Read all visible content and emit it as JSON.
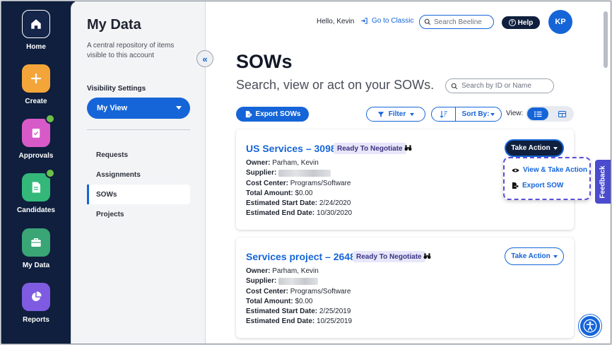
{
  "colors": {
    "rail_bg": "#0f1f3d",
    "accent": "#1565d8",
    "badge_bg": "#e7e6fb",
    "feedback": "#4a4bcd",
    "notification": "#6cc04a"
  },
  "rail": {
    "items": [
      {
        "label": "Home",
        "icon": "home-icon",
        "color": "#16254a",
        "notification": false
      },
      {
        "label": "Create",
        "icon": "plus-icon",
        "color": "#f4a53a",
        "notification": false
      },
      {
        "label": "Approvals",
        "icon": "clipboard-check-icon",
        "color": "#d85ac8",
        "notification": true
      },
      {
        "label": "Candidates",
        "icon": "document-icon",
        "color": "#34b87a",
        "notification": true
      },
      {
        "label": "My Data",
        "icon": "briefcase-icon",
        "color": "#3aa575",
        "notification": false
      },
      {
        "label": "Reports",
        "icon": "pie-chart-icon",
        "color": "#7e5be0",
        "notification": false
      }
    ]
  },
  "sidebar": {
    "title": "My Data",
    "description": "A central repository of items visible to this account",
    "visibility_label": "Visibility Settings",
    "visibility_value": "My View",
    "nav": [
      {
        "label": "Requests",
        "active": false
      },
      {
        "label": "Assignments",
        "active": false
      },
      {
        "label": "SOWs",
        "active": true
      },
      {
        "label": "Projects",
        "active": false
      }
    ]
  },
  "header": {
    "greeting": "Hello, Kevin",
    "classic_link": "Go to Classic",
    "search_placeholder": "Search Beeline",
    "help_label": "Help",
    "avatar_initials": "KP"
  },
  "main": {
    "title": "SOWs",
    "subtitle": "Search, view or act on your SOWs.",
    "search_placeholder": "Search by ID or Name",
    "export_label": "Export SOWs",
    "filter_label": "Filter",
    "sort_label": "Sort By:",
    "view_label": "View:"
  },
  "labels": {
    "owner": "Owner:",
    "supplier": "Supplier:",
    "cost_center": "Cost Center:",
    "total_amount": "Total Amount:",
    "start_date": "Estimated Start Date:",
    "end_date": "Estimated End Date:",
    "take_action": "Take Action"
  },
  "sows": [
    {
      "title": "US Services – 3098",
      "status": "Ready To Negotiate",
      "owner": "Parham, Kevin",
      "cost_center": "Programs/Software",
      "total_amount": "$0.00",
      "start_date": "2/24/2020",
      "end_date": "10/30/2020"
    },
    {
      "title": "Services project – 2648",
      "status": "Ready To Negotiate",
      "owner": "Parham, Kevin",
      "cost_center": "Programs/Software",
      "total_amount": "$0.00",
      "start_date": "2/25/2019",
      "end_date": "10/25/2019"
    }
  ],
  "action_menu": {
    "items": [
      {
        "label": "View & Take Action",
        "icon": "eye-icon"
      },
      {
        "label": "Export SOW",
        "icon": "export-file-icon"
      }
    ]
  },
  "feedback_label": "Feedback"
}
